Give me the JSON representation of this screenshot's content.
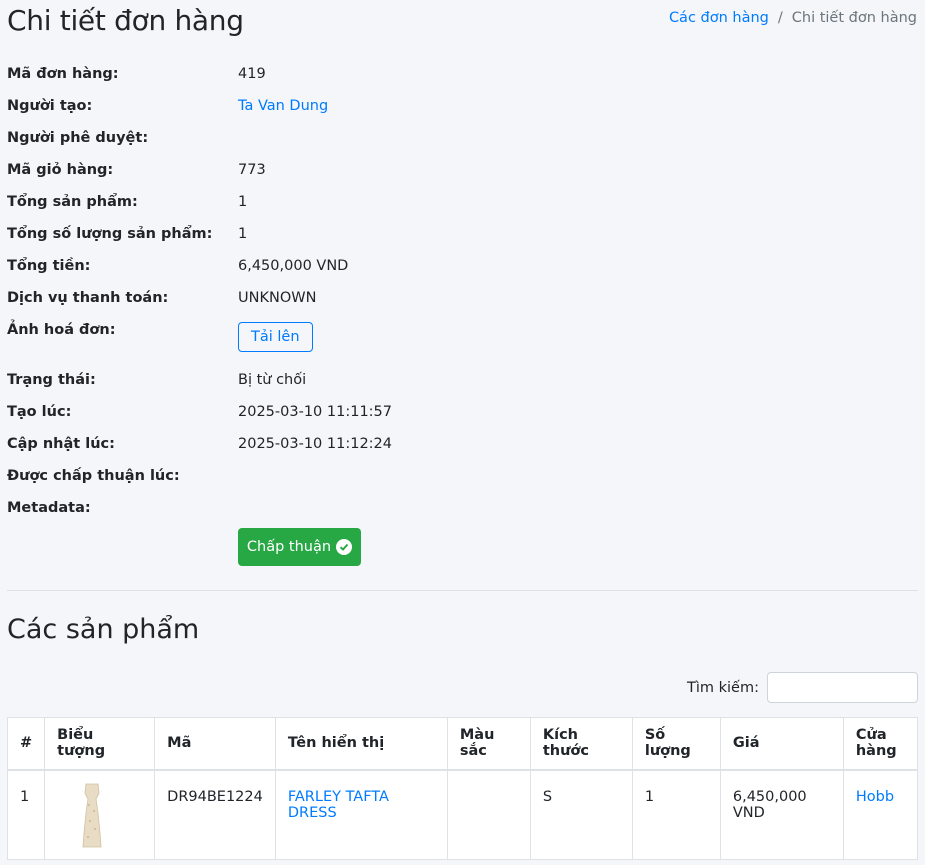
{
  "header": {
    "title": "Chi tiết đơn hàng",
    "breadcrumb": {
      "link": "Các đơn hàng",
      "separator": "/",
      "current": "Chi tiết đơn hàng"
    }
  },
  "details": {
    "order_id": {
      "label": "Mã đơn hàng:",
      "value": "419"
    },
    "creator": {
      "label": "Người tạo:",
      "value": "Ta Van Dung"
    },
    "approver": {
      "label": "Người phê duyệt:",
      "value": ""
    },
    "cart_id": {
      "label": "Mã giỏ hàng:",
      "value": "773"
    },
    "total_products": {
      "label": "Tổng sản phẩm:",
      "value": "1"
    },
    "total_quantity": {
      "label": "Tổng số lượng sản phẩm:",
      "value": "1"
    },
    "total_amount": {
      "label": "Tổng tiền:",
      "value": "6,450,000 VND"
    },
    "payment_service": {
      "label": "Dịch vụ thanh toán:",
      "value": "UNKNOWN"
    },
    "invoice_image": {
      "label": "Ảnh hoá đơn:",
      "button": "Tải lên"
    },
    "status": {
      "label": "Trạng thái:",
      "value": "Bị từ chối"
    },
    "created_at": {
      "label": "Tạo lúc:",
      "value": "2025-03-10 11:11:57"
    },
    "updated_at": {
      "label": "Cập nhật lúc:",
      "value": "2025-03-10 11:12:24"
    },
    "approved_at": {
      "label": "Được chấp thuận lúc:",
      "value": ""
    },
    "metadata": {
      "label": "Metadata:",
      "value": ""
    }
  },
  "approve_button": "Chấp thuận",
  "products": {
    "title": "Các sản phẩm",
    "search_label": "Tìm kiếm:",
    "search_placeholder": "",
    "columns": [
      "#",
      "Biểu tượng",
      "Mã",
      "Tên hiển thị",
      "Màu sắc",
      "Kích thước",
      "Số lượng",
      "Giá",
      "Cửa hàng"
    ],
    "rows": [
      {
        "index": "1",
        "icon": "dress-thumbnail",
        "code": "DR94BE1224",
        "name": "FARLEY TAFTA DRESS",
        "color": "",
        "size": "S",
        "quantity": "1",
        "price": "6,450,000 VND",
        "store": "Hobb"
      }
    ]
  },
  "colors": {
    "link": "#007bff",
    "approve": "#28a745",
    "background": "#f4f6f9"
  }
}
